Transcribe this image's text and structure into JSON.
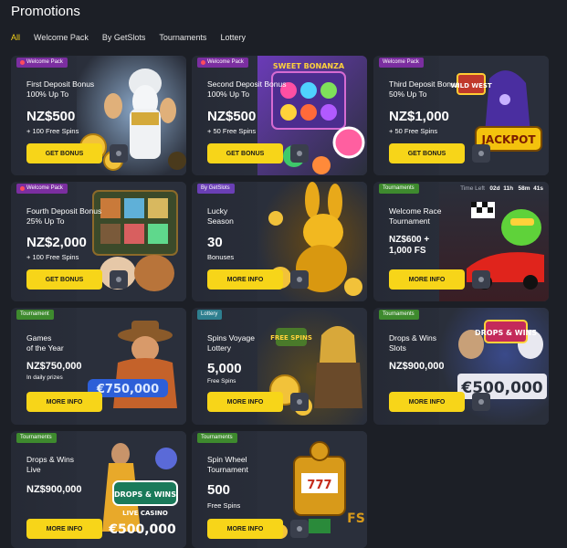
{
  "page_title": "Promotions",
  "tabs": [
    "All",
    "Welcome Pack",
    "By GetSlots",
    "Tournaments",
    "Lottery"
  ],
  "colors": {
    "accent": "#f7d519",
    "background": "#1c1f26",
    "card": "#2a2f3b"
  },
  "cards": [
    {
      "badge": "Welcome Pack",
      "title": "First Deposit Bonus\n100% Up To",
      "amount": "NZ$500",
      "sub": "+ 100 Free Spins",
      "button": "GET BONUS"
    },
    {
      "badge": "Welcome Pack",
      "title": "Second Deposit Bonus\n100% Up To",
      "amount": "NZ$500",
      "sub": "+ 50 Free Spins",
      "button": "GET BONUS"
    },
    {
      "badge": "Welcome Pack",
      "title": "Third Deposit Bonus\n50% Up To",
      "amount": "NZ$1,000",
      "sub": "+ 50 Free Spins",
      "button": "GET BONUS"
    },
    {
      "badge": "Welcome Pack",
      "title": "Fourth Deposit Bonus\n25% Up To",
      "amount": "NZ$2,000",
      "sub": "+ 100 Free Spins",
      "button": "GET BONUS"
    },
    {
      "badge": "By GetSlots",
      "title": "Lucky\nSeason",
      "amount": "30",
      "sub": "Bonuses",
      "button": "MORE INFO"
    },
    {
      "badge": "Tournaments",
      "title": "Welcome Race\nTournament",
      "amount": "NZ$600 +\n1,000 FS",
      "sub": "",
      "button": "MORE INFO",
      "timer": {
        "label": "Time Left",
        "d": "02d",
        "h": "11h",
        "m": "58m",
        "s": "41s"
      }
    },
    {
      "badge": "Tournament",
      "title": "Games\nof the Year",
      "amount": "NZ$750,000",
      "sub": "In daily prizes",
      "button": "MORE INFO"
    },
    {
      "badge": "Lottery",
      "title": "Spins Voyage\nLottery",
      "amount": "5,000",
      "sub": "Free Spins",
      "button": "MORE INFO"
    },
    {
      "badge": "Tournaments",
      "title": "Drops & Wins\nSlots",
      "amount": "NZ$900,000",
      "sub": "",
      "button": "MORE INFO"
    },
    {
      "badge": "Tournaments",
      "title": "Drops & Wins\nLive",
      "amount": "NZ$900,000",
      "sub": "",
      "button": "MORE INFO"
    },
    {
      "badge": "Tournaments",
      "title": "Spin Wheel\nTournament",
      "amount": "500",
      "sub": "Free Spins",
      "button": "MORE INFO"
    }
  ],
  "artwork_text": {
    "a2": "SWEET BONANZA",
    "a3a": "WILD WEST",
    "a3b": "JACKPOT",
    "a7": "€750,000",
    "a8": "FREE SPINS",
    "a9a": "DROPS & WINS",
    "a9b": "€500,000",
    "a10a": "DROPS & WINS",
    "a10b": "LIVE CASINO",
    "a10c": "€500,000",
    "a11": "FS"
  }
}
